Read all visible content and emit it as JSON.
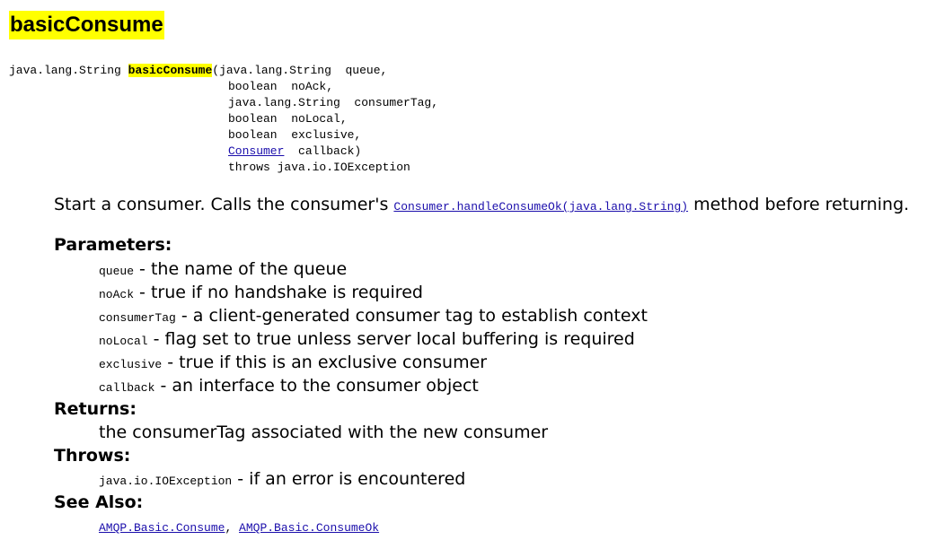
{
  "method_name": "basicConsume",
  "signature": {
    "return_type": "java.lang.String",
    "name": "basicConsume",
    "open": "(java.lang.String  queue,",
    "lines": [
      "boolean  noAck,",
      "java.lang.String  consumerTag,",
      "boolean  noLocal,",
      "boolean  exclusive,"
    ],
    "callback_type": "Consumer",
    "callback_rest": "  callback)",
    "throws": "throws java.io.IOException"
  },
  "description": {
    "before": "Start a consumer. Calls the consumer's ",
    "link": "Consumer.handleConsumeOk(java.lang.String)",
    "after": " method before returning."
  },
  "parameters": {
    "label": "Parameters:",
    "items": [
      {
        "name": "queue",
        "desc": " - the name of the queue"
      },
      {
        "name": "noAck",
        "desc": " - true if no handshake is required"
      },
      {
        "name": "consumerTag",
        "desc": " - a client-generated consumer tag to establish context"
      },
      {
        "name": "noLocal",
        "desc": " - flag set to true unless server local buffering is required"
      },
      {
        "name": "exclusive",
        "desc": " - true if this is an exclusive consumer"
      },
      {
        "name": "callback",
        "desc": " - an interface to the consumer object"
      }
    ]
  },
  "returns": {
    "label": "Returns:",
    "text": "the consumerTag associated with the new consumer"
  },
  "throws": {
    "label": "Throws:",
    "exception": "java.io.IOException",
    "desc": " - if an error is encountered"
  },
  "see_also": {
    "label": "See Also:",
    "links": [
      "AMQP.Basic.Consume",
      "AMQP.Basic.ConsumeOk"
    ],
    "separator": ", "
  }
}
